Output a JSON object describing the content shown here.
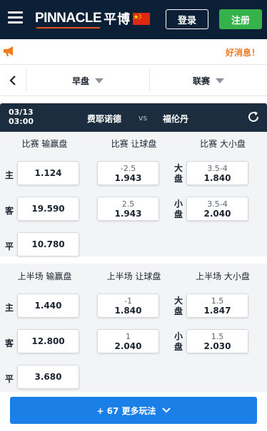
{
  "header": {
    "logo_text": "PINNACLE",
    "logo_cn": "平博",
    "login_label": "登录",
    "register_label": "注册",
    "colors": {
      "bg": "#0b1f36",
      "register": "#36b24a"
    }
  },
  "announcement": {
    "text": "好消息！"
  },
  "filters": {
    "period": "早盘",
    "competition": "联赛"
  },
  "match": {
    "date": "03/13",
    "time": "03:00",
    "home": "费耶诺德",
    "vs": "vs",
    "away": "福伦丹"
  },
  "full_time": {
    "moneyline_title": "比赛 输赢盘",
    "handicap_title": "比赛 让球盘",
    "total_title": "比赛 大小盘",
    "labels": {
      "home": "主",
      "away": "客",
      "draw": "平",
      "over_1": "大",
      "over_2": "盘",
      "under_1": "小",
      "under_2": "盘"
    },
    "moneyline": {
      "home": "1.124",
      "away": "19.590",
      "draw": "10.780"
    },
    "handicap": [
      {
        "line": "-2.5",
        "price": "1.943"
      },
      {
        "line": "2.5",
        "price": "1.943"
      }
    ],
    "total": [
      {
        "line": "3.5-4",
        "price": "1.840"
      },
      {
        "line": "3.5-4",
        "price": "2.040"
      }
    ]
  },
  "first_half": {
    "moneyline_title": "上半场 输赢盘",
    "handicap_title": "上半场 让球盘",
    "total_title": "上半场 大小盘",
    "moneyline": {
      "home": "1.440",
      "away": "12.800",
      "draw": "3.680"
    },
    "handicap": [
      {
        "line": "-1",
        "price": "1.840"
      },
      {
        "line": "1",
        "price": "2.040"
      }
    ],
    "total": [
      {
        "line": "1.5",
        "price": "1.847"
      },
      {
        "line": "1.5",
        "price": "2.030"
      }
    ]
  },
  "more_button": {
    "label": "+ 67 更多玩法"
  },
  "icons": [
    "menu-icon",
    "flag-icon",
    "megaphone-icon",
    "chevron-left-icon",
    "caret-down-icon",
    "refresh-icon",
    "chevron-down-icon"
  ]
}
